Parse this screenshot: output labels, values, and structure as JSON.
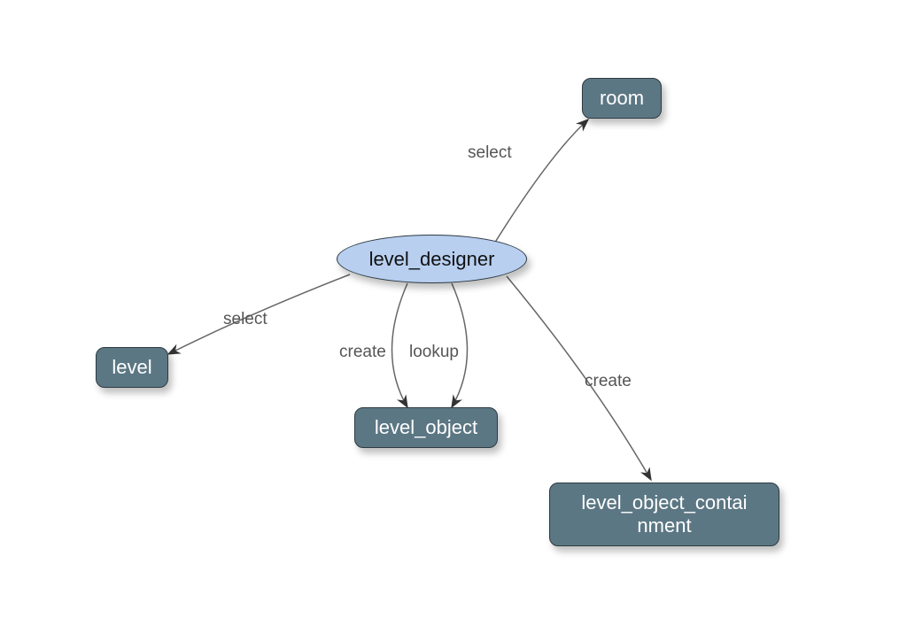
{
  "diagram": {
    "type": "entity-relationship",
    "center_node": {
      "id": "level_designer",
      "label": "level_designer",
      "shape": "ellipse"
    },
    "nodes": {
      "room": {
        "label": "room",
        "shape": "rect"
      },
      "level": {
        "label": "level",
        "shape": "rect"
      },
      "level_object": {
        "label": "level_object",
        "shape": "rect"
      },
      "level_object_containment": {
        "label": "level_object_contai\nnment",
        "shape": "rect"
      }
    },
    "edges": [
      {
        "from": "level_designer",
        "to": "room",
        "label": "select"
      },
      {
        "from": "level_designer",
        "to": "level",
        "label": "select"
      },
      {
        "from": "level_designer",
        "to": "level_object",
        "label": "create"
      },
      {
        "from": "level_designer",
        "to": "level_object",
        "label": "lookup"
      },
      {
        "from": "level_designer",
        "to": "level_object_containment",
        "label": "create"
      }
    ],
    "edge_labels": {
      "select_room": "select",
      "select_level": "select",
      "create_level_object": "create",
      "lookup_level_object": "lookup",
      "create_containment": "create"
    },
    "colors": {
      "rect_fill": "#5c7784",
      "ellipse_fill": "#b8cff0",
      "text_light": "#ffffff",
      "text_dark": "#111111",
      "edge_stroke": "#666666"
    }
  }
}
